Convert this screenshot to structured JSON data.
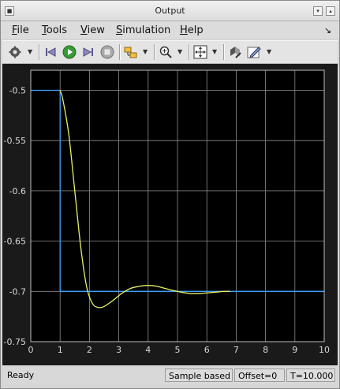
{
  "window": {
    "title": "Output"
  },
  "menu": {
    "items": [
      {
        "label": "File"
      },
      {
        "label": "Tools"
      },
      {
        "label": "View"
      },
      {
        "label": "Simulation"
      },
      {
        "label": "Help"
      }
    ]
  },
  "toolbar": {
    "icons": [
      "gear-icon",
      "step-back-icon",
      "run-icon",
      "step-forward-icon",
      "stop-icon",
      "signal-select-icon",
      "zoom-in-icon",
      "autoscale-icon",
      "highlight-block-icon",
      "style-icon"
    ]
  },
  "status": {
    "ready": "Ready",
    "mode": "Sample based",
    "offset": "Offset=0",
    "time": "T=10.000"
  },
  "colors": {
    "step": "#3aa0ff",
    "response": "#e8f060",
    "plot_bg": "#000000",
    "grid": "#8c8c8c"
  },
  "chart_data": {
    "type": "line",
    "xlim": [
      0,
      10
    ],
    "ylim": [
      -0.75,
      -0.48
    ],
    "x_ticks": [
      "0",
      "1",
      "2",
      "3",
      "4",
      "5",
      "6",
      "7",
      "8",
      "9",
      "10"
    ],
    "y_ticks": [
      "-0.5",
      "-0.55",
      "-0.6",
      "-0.65",
      "-0.7",
      "-0.75"
    ],
    "grid": true,
    "series": [
      {
        "color": "#3aa0ff",
        "x": [
          0,
          1,
          1,
          10
        ],
        "y": [
          -0.5,
          -0.5,
          -0.7,
          -0.7
        ]
      },
      {
        "color": "#e8f060",
        "x": [
          1,
          1.1,
          1.3,
          1.5,
          1.7,
          1.9,
          2.1,
          2.3,
          2.5,
          2.8,
          3.1,
          3.4,
          3.7,
          4.0,
          4.3,
          4.7,
          5.0,
          5.4,
          5.8,
          6.2,
          6.6,
          6.8
        ],
        "y": [
          -0.5,
          -0.51,
          -0.545,
          -0.6,
          -0.655,
          -0.695,
          -0.712,
          -0.716,
          -0.715,
          -0.709,
          -0.702,
          -0.697,
          -0.695,
          -0.694,
          -0.695,
          -0.698,
          -0.7,
          -0.702,
          -0.702,
          -0.701,
          -0.7,
          -0.7
        ]
      }
    ]
  }
}
